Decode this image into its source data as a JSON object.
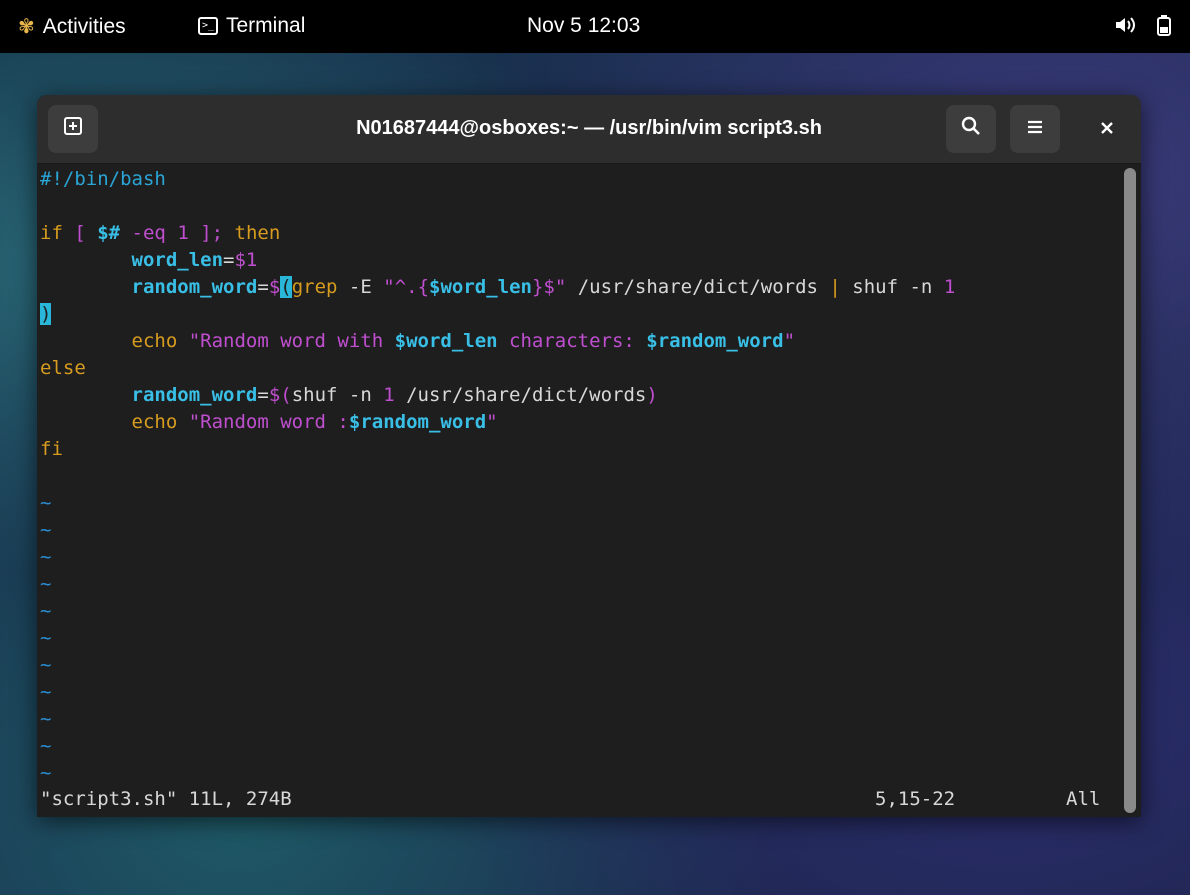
{
  "topbar": {
    "activities": "Activities",
    "app": "Terminal",
    "clock": "Nov 5  12:03"
  },
  "window": {
    "title": "N01687444@osboxes:~ — /usr/bin/vim script3.sh"
  },
  "editor": {
    "lines": [
      [
        {
          "t": "#!/bin/bash",
          "c": "c-cyan"
        }
      ],
      [],
      [
        {
          "t": "if",
          "c": "c-yellow"
        },
        {
          "t": " [ ",
          "c": "c-mag"
        },
        {
          "t": "$#",
          "c": "c-var"
        },
        {
          "t": " -eq ",
          "c": "c-mag"
        },
        {
          "t": "1",
          "c": "c-mag"
        },
        {
          "t": " ]; ",
          "c": "c-mag"
        },
        {
          "t": "then",
          "c": "c-yellow"
        }
      ],
      [
        {
          "t": "        ",
          "c": "c-white"
        },
        {
          "t": "word_len",
          "c": "c-var"
        },
        {
          "t": "=",
          "c": "c-white"
        },
        {
          "t": "$1",
          "c": "c-mag"
        }
      ],
      [
        {
          "t": "        ",
          "c": "c-white"
        },
        {
          "t": "random_word",
          "c": "c-var"
        },
        {
          "t": "=",
          "c": "c-white"
        },
        {
          "t": "$",
          "c": "c-mag"
        },
        {
          "t": "(",
          "c": "cursor"
        },
        {
          "t": "grep",
          "c": "c-yellow"
        },
        {
          "t": " -E ",
          "c": "c-white"
        },
        {
          "t": "\"^.{",
          "c": "c-mag"
        },
        {
          "t": "$word_len",
          "c": "c-var"
        },
        {
          "t": "}$\"",
          "c": "c-mag"
        },
        {
          "t": " /usr/share/dict/words ",
          "c": "c-white"
        },
        {
          "t": "|",
          "c": "c-yellow"
        },
        {
          "t": " shuf -n ",
          "c": "c-white"
        },
        {
          "t": "1",
          "c": "c-mag"
        }
      ],
      [
        {
          "t": ")",
          "c": "cursor"
        }
      ],
      [
        {
          "t": "        ",
          "c": "c-white"
        },
        {
          "t": "echo",
          "c": "c-yellow"
        },
        {
          "t": " \"Random word with ",
          "c": "c-mag"
        },
        {
          "t": "$word_len",
          "c": "c-var"
        },
        {
          "t": " characters: ",
          "c": "c-mag"
        },
        {
          "t": "$random_word",
          "c": "c-var"
        },
        {
          "t": "\"",
          "c": "c-mag"
        }
      ],
      [
        {
          "t": "else",
          "c": "c-yellow"
        }
      ],
      [
        {
          "t": "        ",
          "c": "c-white"
        },
        {
          "t": "random_word",
          "c": "c-var"
        },
        {
          "t": "=",
          "c": "c-white"
        },
        {
          "t": "$(",
          "c": "c-mag"
        },
        {
          "t": "shuf -n ",
          "c": "c-white"
        },
        {
          "t": "1",
          "c": "c-mag"
        },
        {
          "t": " /usr/share/dict/words",
          "c": "c-white"
        },
        {
          "t": ")",
          "c": "c-mag"
        }
      ],
      [
        {
          "t": "        ",
          "c": "c-white"
        },
        {
          "t": "echo",
          "c": "c-yellow"
        },
        {
          "t": " \"Random word :",
          "c": "c-mag"
        },
        {
          "t": "$random_word",
          "c": "c-var"
        },
        {
          "t": "\"",
          "c": "c-mag"
        }
      ],
      [
        {
          "t": "fi",
          "c": "c-yellow"
        }
      ]
    ],
    "tilde_count": 11,
    "tilde_char": "~"
  },
  "statusline": {
    "file_info": "\"script3.sh\" 11L, 274B",
    "position": "5,15-22",
    "scroll": "All"
  },
  "icons": {
    "activities": "gnome-flower-icon",
    "terminal": "terminal-icon",
    "volume": "volume-icon",
    "battery": "battery-icon",
    "new_tab": "new-tab-icon",
    "search": "search-icon",
    "menu": "hamburger-menu-icon",
    "close": "close-icon"
  }
}
